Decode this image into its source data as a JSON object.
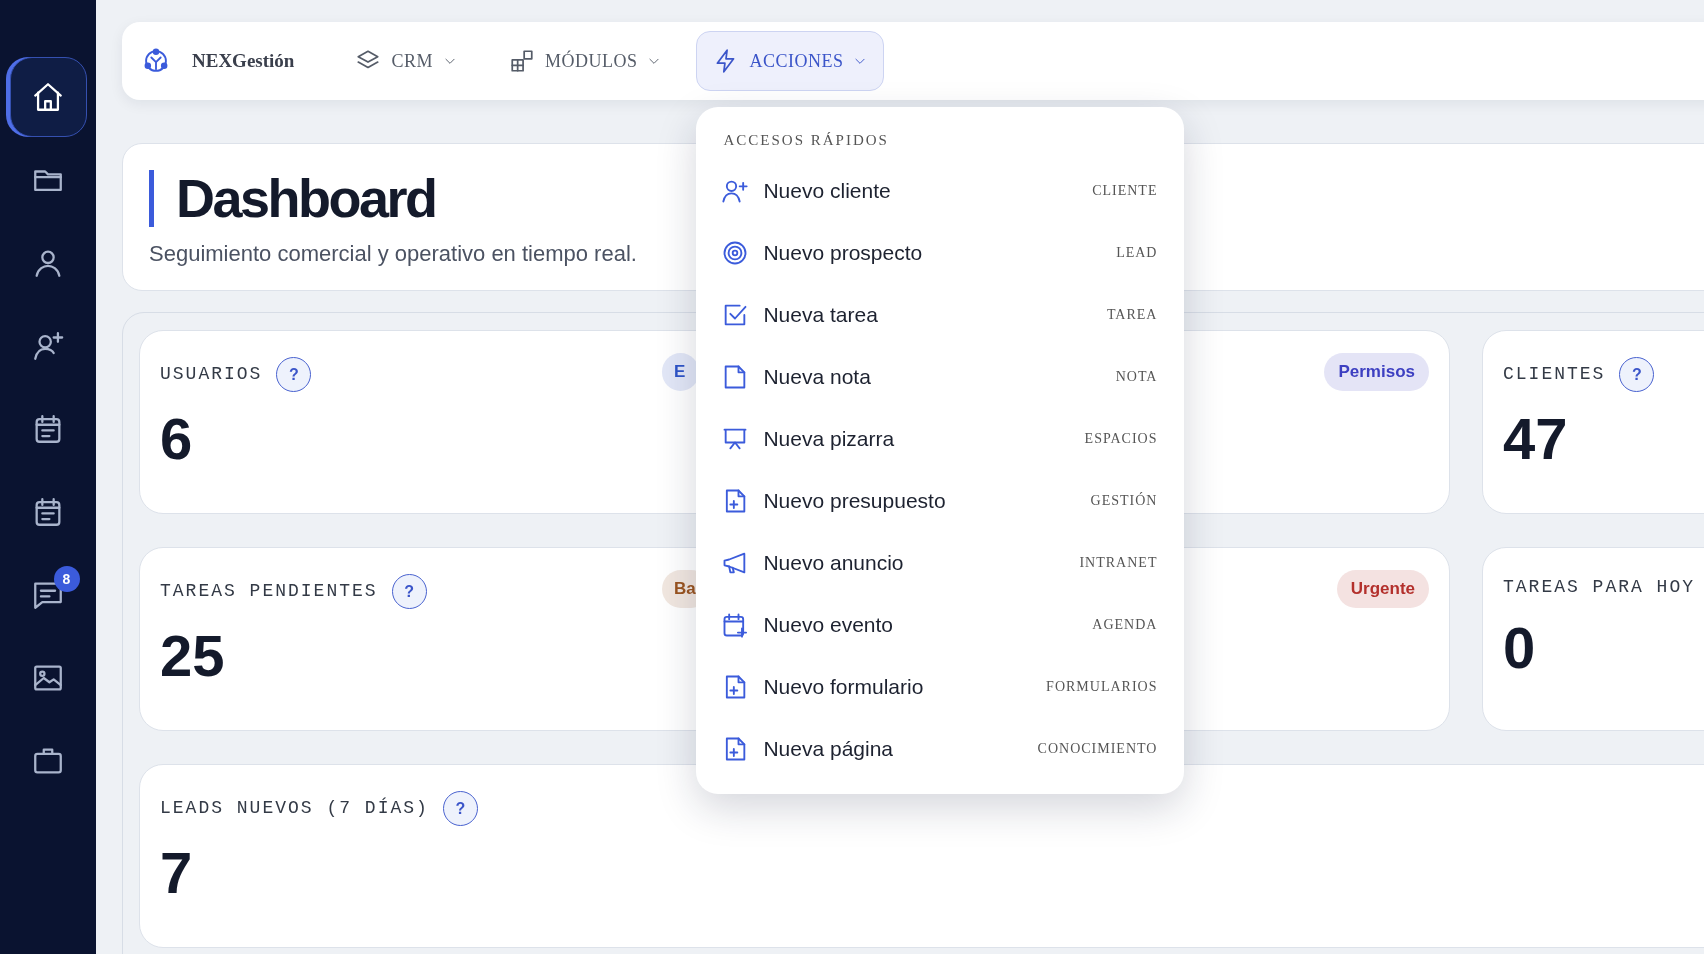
{
  "sidebar": {
    "items": [
      {
        "selected": true
      },
      {
        "selected": false
      },
      {
        "selected": false
      },
      {
        "selected": false
      },
      {
        "selected": false
      },
      {
        "selected": false
      },
      {
        "selected": false,
        "badge": "8"
      },
      {
        "selected": false
      },
      {
        "selected": false
      }
    ]
  },
  "topbar": {
    "brand": "NEXGestión",
    "nav": [
      {
        "label": "CRM",
        "selected": false
      },
      {
        "label": "MÓDULOS",
        "selected": false
      },
      {
        "label": "ACCIONES",
        "selected": true
      }
    ]
  },
  "menu": {
    "heading": "ACCESOS RÁPIDOS",
    "items": [
      {
        "label": "Nuevo cliente",
        "tag": "CLIENTE"
      },
      {
        "label": "Nuevo prospecto",
        "tag": "LEAD"
      },
      {
        "label": "Nueva tarea",
        "tag": "TAREA"
      },
      {
        "label": "Nueva nota",
        "tag": "NOTA"
      },
      {
        "label": "Nueva pizarra",
        "tag": "ESPACIOS"
      },
      {
        "label": "Nuevo presupuesto",
        "tag": "GESTIÓN"
      },
      {
        "label": "Nuevo anuncio",
        "tag": "INTRANET"
      },
      {
        "label": "Nuevo evento",
        "tag": "AGENDA"
      },
      {
        "label": "Nuevo formulario",
        "tag": "FORMULARIOS"
      },
      {
        "label": "Nueva página",
        "tag": "CONOCIMIENTO"
      }
    ]
  },
  "header": {
    "title": "Dashboard",
    "subtitle": "Seguimiento comercial y operativo en tiempo real."
  },
  "stats": [
    [
      {
        "label": "USUARIOS",
        "help": "?",
        "value": "6",
        "badge": {
          "text": "E",
          "color": "#2f55c8"
        }
      },
      {
        "badge": {
          "text": "Permisos",
          "color": "#3d3fc1"
        }
      },
      {
        "label": "CLIENTES",
        "help": "?",
        "value": "47"
      }
    ],
    [
      {
        "label": "TAREAS PENDIENTES",
        "help": "?",
        "value": "25",
        "badge": {
          "text": "Ba",
          "color": "#9a5420"
        }
      },
      {
        "badge": {
          "text": "Urgente",
          "color": "#b3302c"
        }
      },
      {
        "label": "TAREAS PARA HOY",
        "value": "0"
      }
    ],
    [
      {
        "label": "LEADS NUEVOS (7 DÍAS)",
        "help": "?",
        "value": "7"
      }
    ]
  ]
}
